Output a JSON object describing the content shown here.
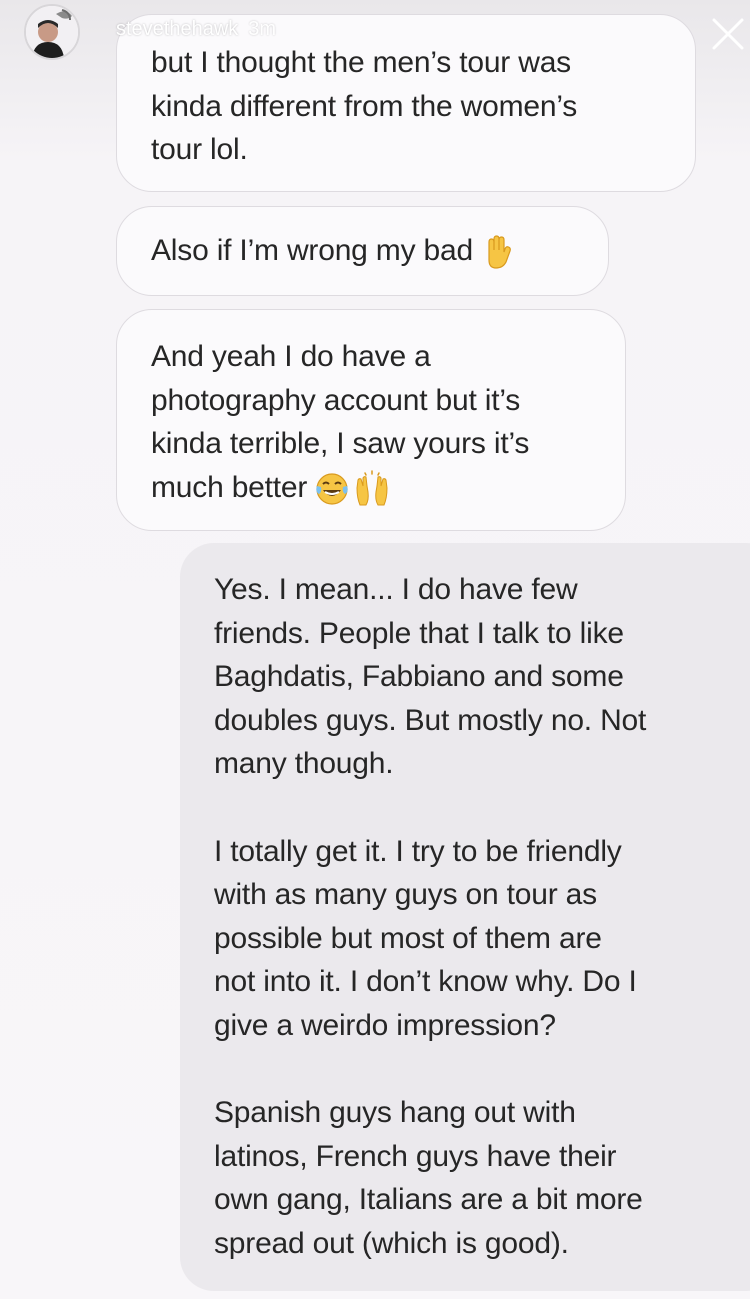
{
  "story": {
    "username": "stevethehawk",
    "time": "3m"
  },
  "messages": [
    {
      "sender": "other",
      "text": "but I thought the men’s tour was\nkinda different from the women’s\ntour lol."
    },
    {
      "sender": "other",
      "text": "Also if I’m wrong my bad",
      "emojis": [
        "raised-hand-emoji"
      ]
    },
    {
      "sender": "other",
      "text": "And yeah I do have a\nphotography account but it’s\nkinda terrible, I saw yours it’s\nmuch better",
      "emojis": [
        "tears-of-joy-emoji",
        "raising-hands-emoji"
      ]
    },
    {
      "sender": "me",
      "paragraphs": [
        "Yes. I mean... I do have few\nfriends. People that I talk to like\nBaghdatis, Fabbiano and some\ndoubles guys. But mostly no. Not\nmany though.",
        "I totally get it. I try to be friendly\nwith as many guys on tour as\npossible but most of them are\nnot into it. I don’t know why. Do I\ngive a weirdo impression?",
        "Spanish guys hang out with\nlatinos, French guys have their\nown gang, Italians are a bit more\nspread out (which is good)."
      ]
    }
  ],
  "colors": {
    "incoming_bubble": "#fbfafc",
    "outgoing_bubble": "#ebe9ed",
    "text": "#262626",
    "emoji_yellow": "#f6c544"
  }
}
